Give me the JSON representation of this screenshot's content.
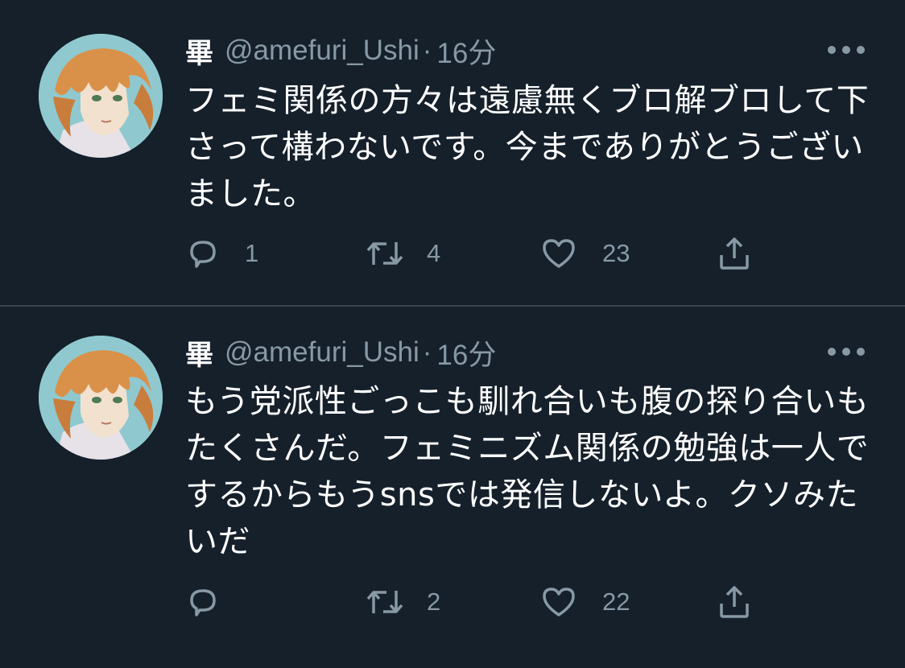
{
  "tweets": [
    {
      "display_name": "畢",
      "handle": "@amefuri_Ushi",
      "separator": "·",
      "time": "16分",
      "text": "フェミ関係の方々は遠慮無くブロ解ブロして下さって構わないです。今までありがとうございました。",
      "reply_count": "1",
      "retweet_count": "4",
      "like_count": "23"
    },
    {
      "display_name": "畢",
      "handle": "@amefuri_Ushi",
      "separator": "·",
      "time": "16分",
      "text": "もう党派性ごっこも馴れ合いも腹の探り合いもたくさんだ。フェミニズム関係の勉強は一人でするからもうsnsでは発信しないよ。クソみたいだ",
      "reply_count": "",
      "retweet_count": "2",
      "like_count": "22"
    }
  ],
  "colors": {
    "background": "#15202b",
    "divider": "#38444d",
    "secondary_text": "#8899a6",
    "primary_text": "#ffffff"
  },
  "icons": {
    "reply": "reply-icon",
    "retweet": "retweet-icon",
    "like": "heart-icon",
    "share": "share-icon",
    "more": "more-options-icon"
  }
}
